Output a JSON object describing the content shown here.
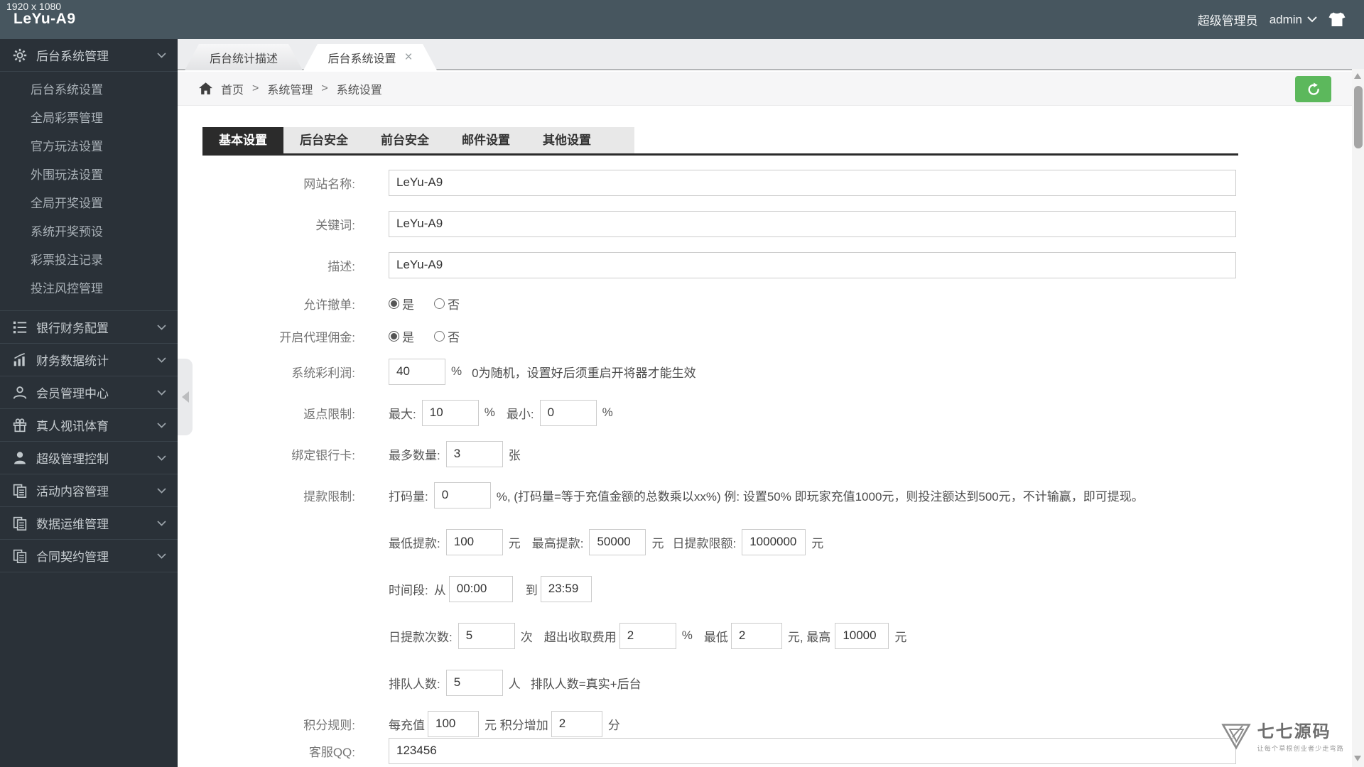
{
  "meta": {
    "resolution_label": "1920  x  1080"
  },
  "header": {
    "logo": "LeYu-A9",
    "role": "超级管理员",
    "username": "admin"
  },
  "sidebar": {
    "groups": [
      {
        "label": "后台系统管理",
        "icon": "gear-icon"
      },
      {
        "label": "银行财务配置",
        "icon": "list-ol-icon"
      },
      {
        "label": "财务数据统计",
        "icon": "bar-chart-icon"
      },
      {
        "label": "会员管理中心",
        "icon": "user-outline-icon"
      },
      {
        "label": "真人视讯体育",
        "icon": "gift-icon"
      },
      {
        "label": "超级管理控制",
        "icon": "user-icon"
      },
      {
        "label": "活动内容管理",
        "icon": "copy-icon"
      },
      {
        "label": "数据运维管理",
        "icon": "copy-icon"
      },
      {
        "label": "合同契约管理",
        "icon": "copy-icon"
      }
    ],
    "submenu": [
      "后台系统设置",
      "全局彩票管理",
      "官方玩法设置",
      "外围玩法设置",
      "全局开奖设置",
      "系统开奖预设",
      "彩票投注记录",
      "投注风控管理"
    ]
  },
  "tabs": {
    "tab1": "后台统计描述",
    "tab2": "后台系统设置",
    "close": "×"
  },
  "breadcrumb": {
    "home": "首页",
    "sep1": ">",
    "level1": "系统管理",
    "sep2": ">",
    "level2": "系统设置"
  },
  "subtabs": {
    "t1": "基本设置",
    "t2": "后台安全",
    "t3": "前台安全",
    "t4": "邮件设置",
    "t5": "其他设置"
  },
  "form": {
    "site_name": {
      "label": "网站名称:",
      "value": "LeYu-A9"
    },
    "keywords": {
      "label": "关键词:",
      "value": "LeYu-A9"
    },
    "description": {
      "label": "描述:",
      "value": "LeYu-A9"
    },
    "allow_cancel": {
      "label": "允许撤单:",
      "yes": "是",
      "no": "否"
    },
    "agent_commission": {
      "label": "开启代理佣金:",
      "yes": "是",
      "no": "否"
    },
    "system_profit": {
      "label": "系统彩利润:",
      "value": "40",
      "unit": "%",
      "note": "0为随机，设置好后须重启开将器才能生效"
    },
    "rebate": {
      "label": "返点限制:",
      "max_label": "最大:",
      "max_value": "10",
      "max_unit": "%",
      "min_label": "最小:",
      "min_value": "0",
      "min_unit": "%"
    },
    "bank_card": {
      "label": "绑定银行卡:",
      "qty_label": "最多数量:",
      "value": "3",
      "unit": "张"
    },
    "withdraw": {
      "label": "提款限制:",
      "code_label": "打码量:",
      "value": "0",
      "note": "%, (打码量=等于充值金额的总数乘以xx%) 例: 设置50% 即玩家充值1000元，则投注额达到500元，不计输赢，即可提现。"
    },
    "withdraw_amounts": {
      "min_label": "最低提款:",
      "min_value": "100",
      "min_unit": "元",
      "max_label": "最高提款:",
      "max_value": "50000",
      "max_unit": "元",
      "daily_label": "日提款限额:",
      "daily_value": "1000000",
      "daily_unit": "元"
    },
    "time_range": {
      "label": "时间段:",
      "from_label": "从",
      "from_value": "00:00",
      "to_label": "到",
      "to_value": "23:59"
    },
    "daily_times": {
      "label": "日提款次数:",
      "value": "5",
      "unit": "次",
      "fee_label": "超出收取费用",
      "fee_value": "2",
      "fee_unit": "%",
      "min_label": "最低",
      "min_value": "2",
      "min_unit": "元, 最高",
      "max_value": "10000",
      "max_unit": "元"
    },
    "queue": {
      "label": "排队人数:",
      "value": "5",
      "unit": "人",
      "note": "排队人数=真实+后台"
    },
    "points": {
      "label": "积分规则:",
      "prefix": "每充值",
      "value1": "100",
      "mid": "元 积分增加",
      "value2": "2",
      "unit": "分"
    },
    "service_qq": {
      "label": "客服QQ:",
      "value": "123456"
    }
  },
  "watermark": {
    "title": "七七源码",
    "slogan": "让每个草根创业者少走弯路"
  },
  "colors": {
    "header_bg": "#47565f",
    "sidebar_bg": "#2a3138",
    "accent_green": "#5cb85c",
    "subtab_active": "#2b2b2b"
  }
}
